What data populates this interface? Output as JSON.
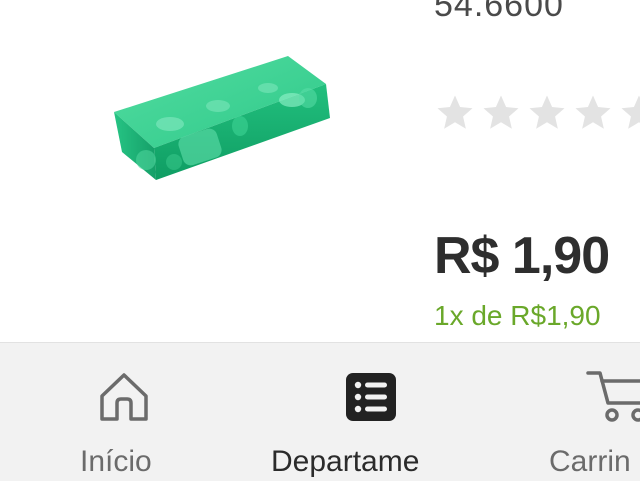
{
  "product": {
    "sku": "54.6600",
    "rating": 0,
    "rating_max": 5,
    "price": "R$ 1,90",
    "installment": "1x de R$1,90"
  },
  "bottom_nav": {
    "items": [
      {
        "label": "Início",
        "icon": "home-icon",
        "active": false
      },
      {
        "label": "Departame",
        "icon": "list-icon",
        "active": true
      },
      {
        "label": "Carrin",
        "icon": "cart-icon",
        "active": false
      }
    ]
  },
  "colors": {
    "installment_green": "#6aa82a",
    "star_empty": "#e3e3e3",
    "nav_background": "#f2f2f2",
    "product_green": "#22c07e"
  }
}
